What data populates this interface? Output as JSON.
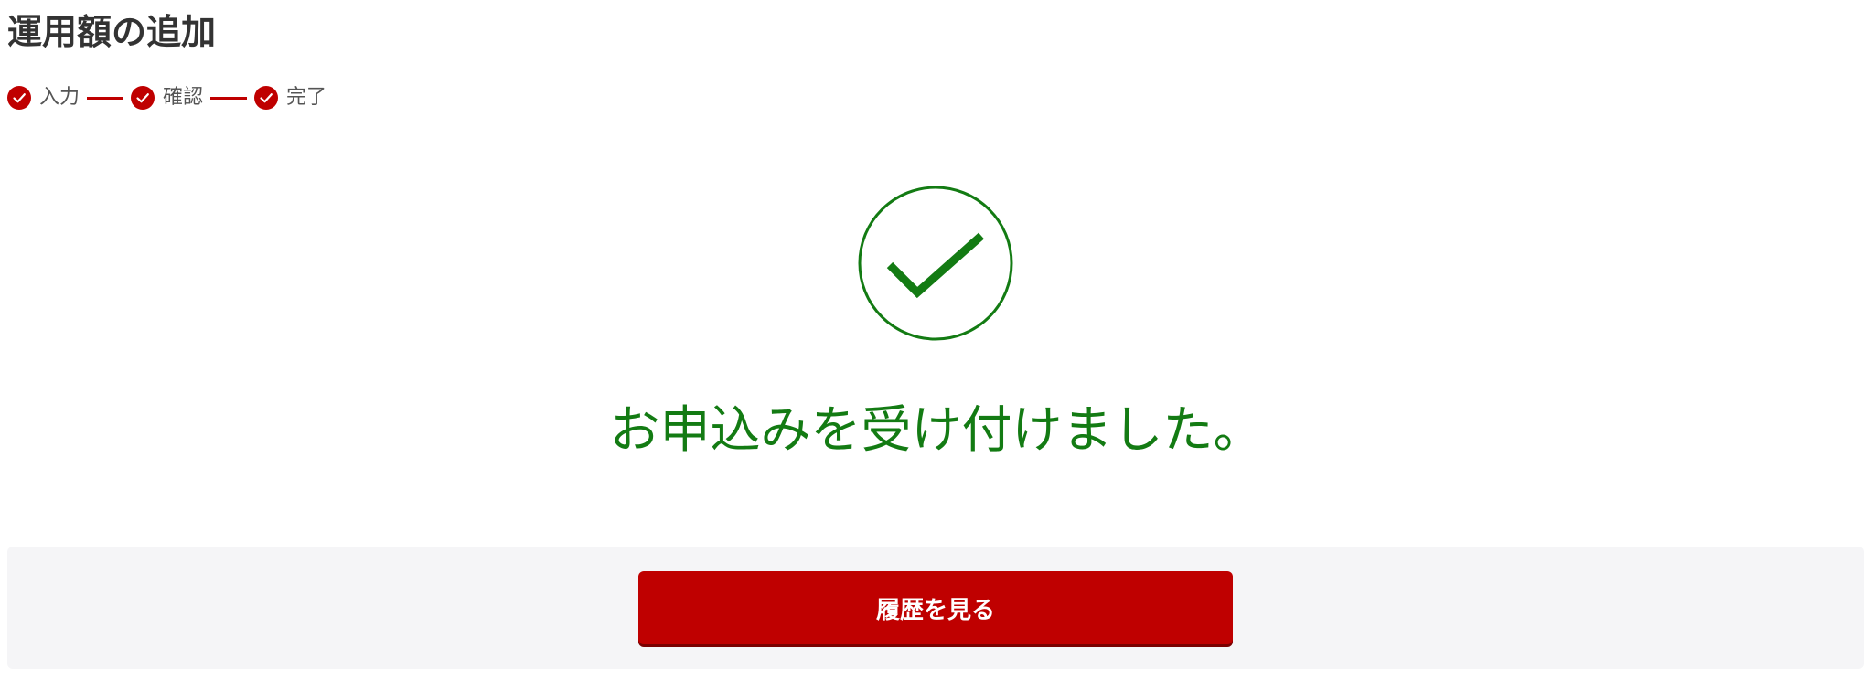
{
  "page": {
    "title": "運用額の追加"
  },
  "steps": [
    {
      "label": "入力",
      "icon": "check-circle-icon",
      "status": "done"
    },
    {
      "label": "確認",
      "icon": "check-circle-icon",
      "status": "done"
    },
    {
      "label": "完了",
      "icon": "check-circle-icon",
      "status": "done"
    }
  ],
  "result": {
    "icon": "check-circle-icon",
    "message": "お申込みを受け付けました。"
  },
  "actions": {
    "history_label": "履歴を見る"
  },
  "colors": {
    "accent": "#bf0000",
    "success": "#137b13",
    "panel_background": "#f5f5f7",
    "text": "#333333"
  }
}
